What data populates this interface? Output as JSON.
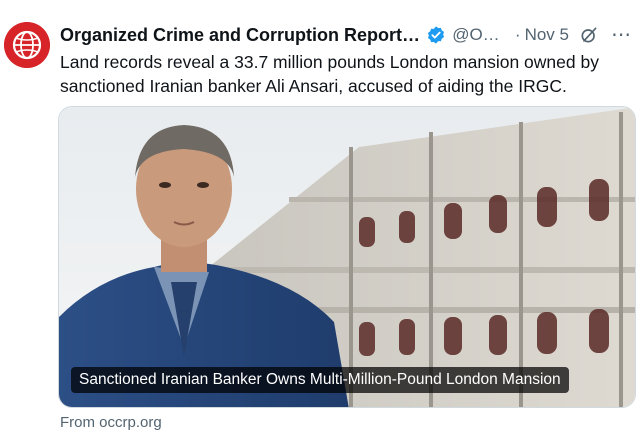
{
  "account": {
    "display_name": "Organized Crime and Corruption Reporting ...",
    "handle": "@OC...",
    "separator": "·",
    "timestamp": "Nov 5",
    "verified_icon": "verified-badge-icon",
    "brand_color": "#d62428"
  },
  "tweet": {
    "text": "Land records reveal a 33.7 million pounds London mansion owned by sanctioned Iranian banker Ali Ansari, accused of aiding the IRGC."
  },
  "card": {
    "caption": "Sanctioned Iranian Banker Owns Multi-Million-Pound London Mansion",
    "source": "From occrp.org"
  },
  "icons": {
    "more": "⋯"
  }
}
